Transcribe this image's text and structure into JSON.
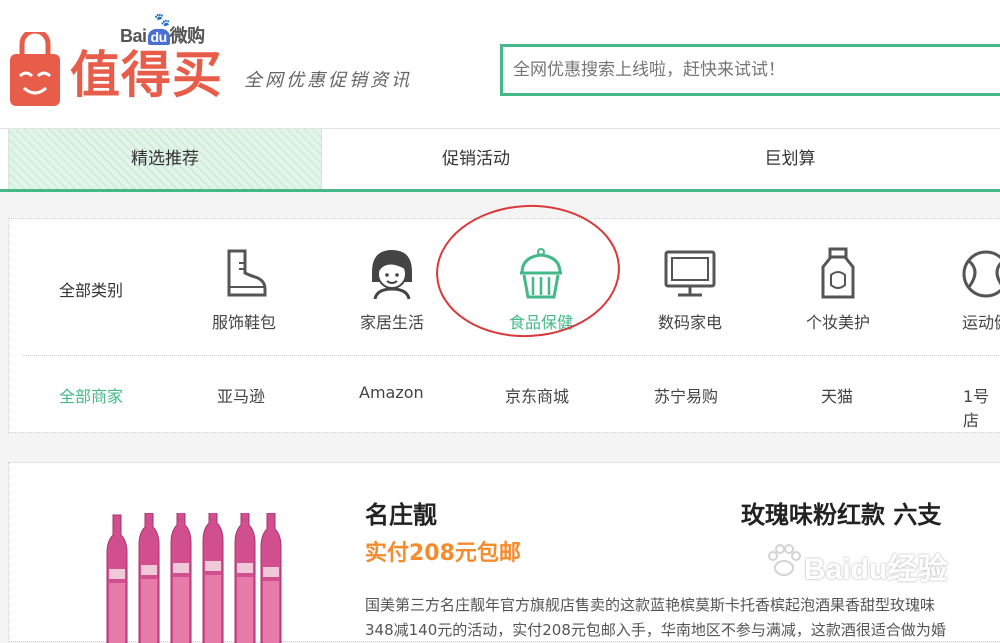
{
  "header": {
    "baidu_mark": "Bai",
    "baidu_du": "du",
    "baidu_suffix": "微购",
    "logo_text": "值得买",
    "slogan": "全网优惠促销资讯",
    "search_placeholder": "全网优惠搜索上线啦，赶快来试试！"
  },
  "nav": {
    "tabs": [
      {
        "label": "精选推荐",
        "active": true
      },
      {
        "label": "促销活动",
        "active": false
      },
      {
        "label": "巨划算",
        "active": false
      }
    ]
  },
  "categories": {
    "row_label": "全部类别",
    "items": [
      {
        "label": "服饰鞋包",
        "icon": "boot-icon"
      },
      {
        "label": "家居生活",
        "icon": "person-face-icon"
      },
      {
        "label": "食品保健",
        "icon": "cupcake-icon",
        "active": true
      },
      {
        "label": "数码家电",
        "icon": "monitor-icon"
      },
      {
        "label": "个妆美护",
        "icon": "bottle-icon"
      },
      {
        "label": "运动健",
        "icon": "tennis-ball-icon"
      }
    ]
  },
  "merchants": {
    "items": [
      "全部商家",
      "亚马逊",
      "Amazon",
      "京东商城",
      "苏宁易购",
      "天猫",
      "1号店"
    ]
  },
  "product": {
    "title_left": "名庄靓",
    "title_right": "玫瑰味粉红款 六支",
    "price": "实付208元包邮",
    "desc_line1": "国美第三方名庄靓年官方旗舰店售卖的这款蓝艳槟莫斯卡托香槟起泡酒果香甜型玫瑰味",
    "desc_line2": "348减140元的活动，实付208元包邮入手，华南地区不参与满减，这款酒很适合做为婚"
  },
  "watermark": {
    "text": "Baidu经验"
  },
  "colors": {
    "accent": "#45b88a",
    "brand": "#e85c4a",
    "price": "#f58b2c",
    "annotation": "#d9393b"
  }
}
